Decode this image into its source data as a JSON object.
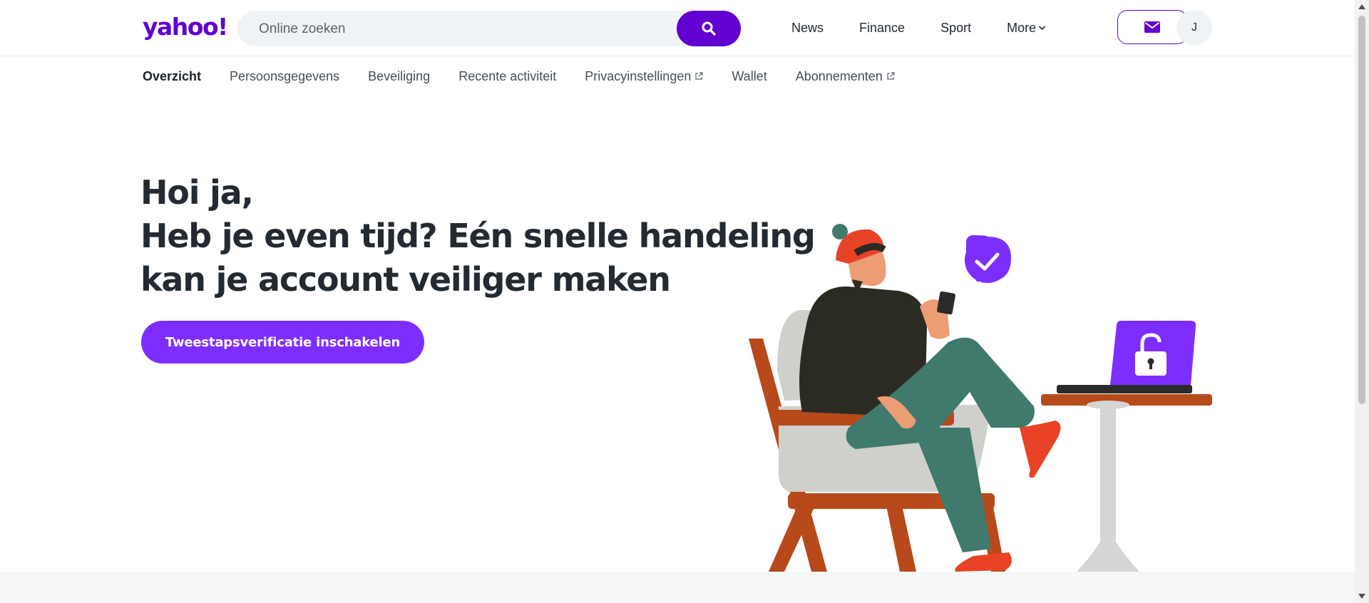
{
  "header": {
    "logo": "yahoo!",
    "search": {
      "placeholder": "Online zoeken",
      "value": ""
    },
    "nav": [
      {
        "label": "News"
      },
      {
        "label": "Finance"
      },
      {
        "label": "Sport"
      },
      {
        "label": "More"
      }
    ],
    "avatar_initial": "J"
  },
  "subnav": {
    "items": [
      {
        "label": "Overzicht",
        "active": true
      },
      {
        "label": "Persoonsgegevens"
      },
      {
        "label": "Beveiliging"
      },
      {
        "label": "Recente activiteit"
      },
      {
        "label": "Privacyinstellingen",
        "external": true
      },
      {
        "label": "Wallet"
      },
      {
        "label": "Abonnementen",
        "external": true
      }
    ]
  },
  "hero": {
    "line1": "Hoi ja,",
    "line2": "Heb je even tijd? Eén snelle handeling",
    "line3": "kan je account veiliger maken",
    "cta_label": "Tweestapsverificatie inschakelen"
  },
  "colors": {
    "brand": "#6001d2",
    "cta": "#7d2eff",
    "text": "#232a31"
  },
  "icons": [
    "search-icon",
    "mail-icon",
    "chevron-down-icon",
    "external-link-icon",
    "check-icon",
    "unlocked-padlock-icon"
  ]
}
